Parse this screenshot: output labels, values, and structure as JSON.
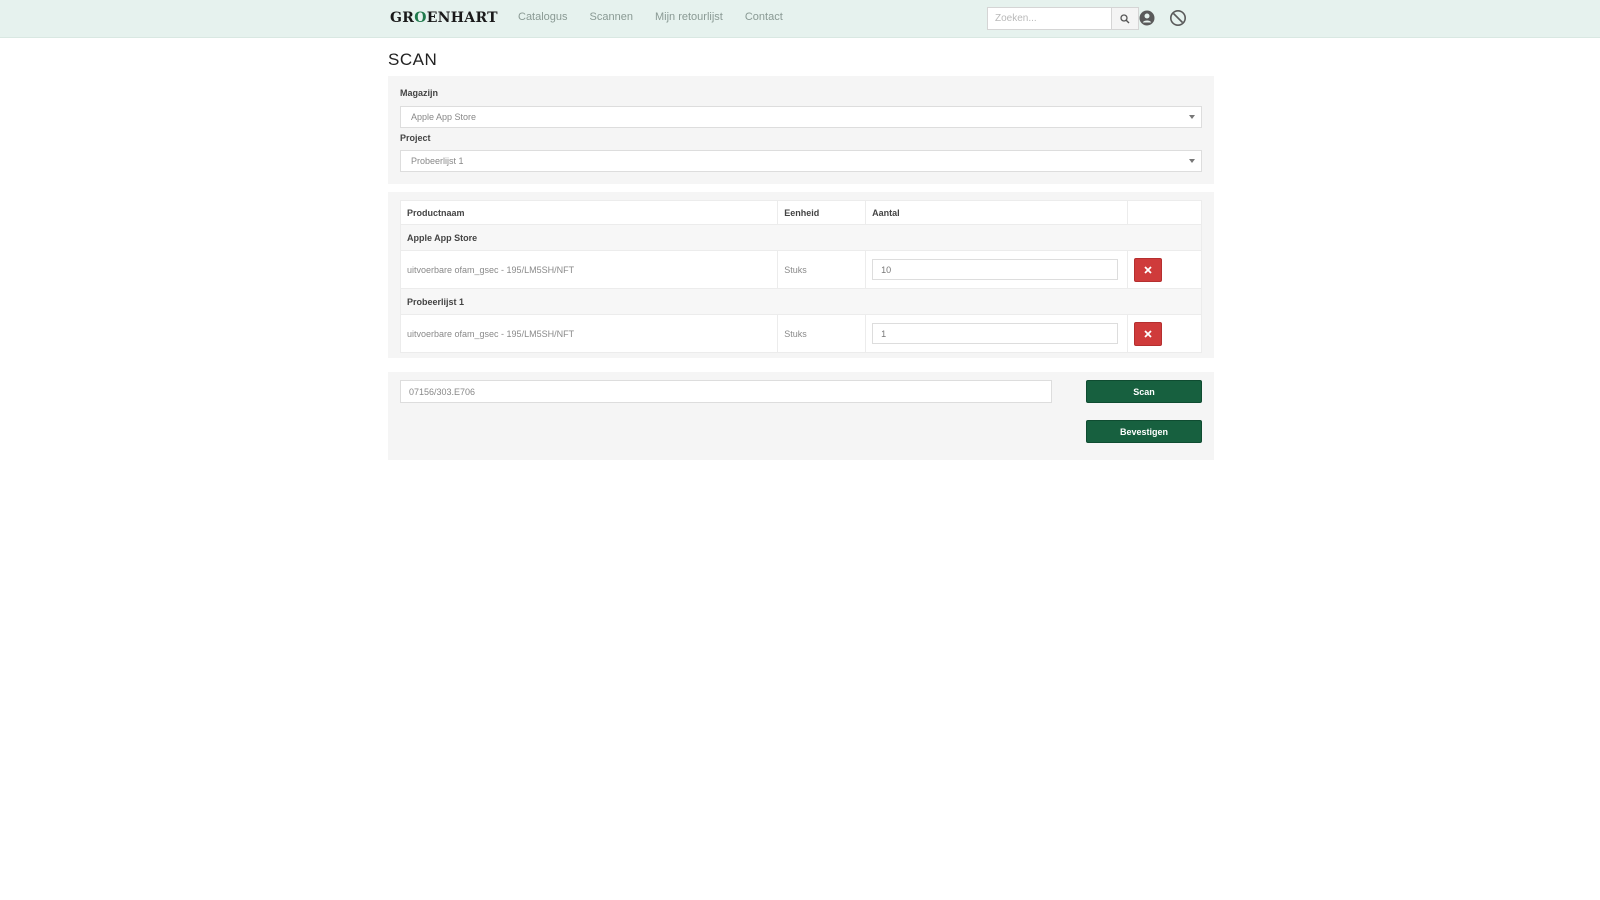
{
  "brand": {
    "logo_prefix": "GR",
    "logo_accent": "O",
    "logo_suffix": "ENHART",
    "accent_color": "#1f7a4c"
  },
  "nav": {
    "links": [
      "Catalogus",
      "Scannen",
      "Mijn retourlijst",
      "Contact"
    ],
    "search_placeholder": "Zoeken...",
    "search_icon": "search-icon",
    "icons": [
      "user-icon",
      "logout-icon"
    ]
  },
  "page": {
    "title": "SCAN"
  },
  "filters": {
    "warehouse_label": "Magazijn",
    "warehouse_value": "Apple App Store",
    "project_label": "Project",
    "project_value": "Probeerlijst 1"
  },
  "table": {
    "headers": [
      "Productnaam",
      "Eenheid",
      "Aantal",
      ""
    ],
    "groups": [
      {
        "name": "Apple App Store",
        "items": [
          {
            "product": "uitvoerbare ofam_gsec - 195/LM5SH/NFT",
            "unit": "Stuks",
            "quantity": "10"
          }
        ]
      },
      {
        "name": "Probeerlijst 1",
        "items": [
          {
            "product": "uitvoerbare ofam_gsec - 195/LM5SH/NFT",
            "unit": "Stuks",
            "quantity": "1"
          }
        ]
      }
    ],
    "delete_color": "#cf3b3b"
  },
  "scan": {
    "input_value": "07156/303.E706",
    "scan_label": "Scan",
    "confirm_label": "Bevestigen",
    "button_color": "#17603f"
  }
}
